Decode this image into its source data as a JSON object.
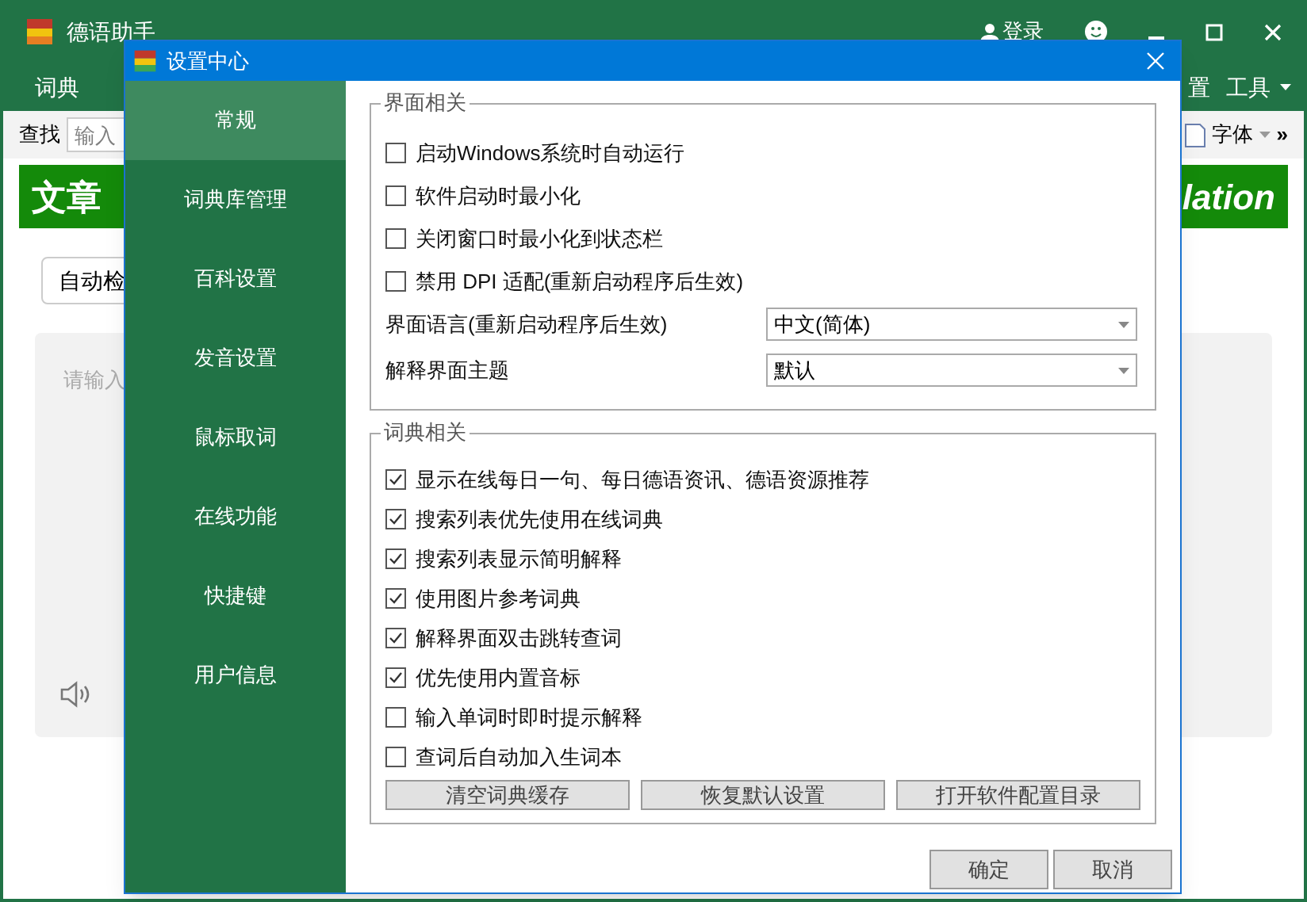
{
  "app": {
    "title": "德语助手",
    "login": "登录",
    "menu": [
      "词典",
      "置",
      "工具"
    ],
    "toolbar": {
      "search_label": "查找",
      "search_placeholder": "输入",
      "font": "字体",
      "more": "»"
    },
    "banner": {
      "left": "文章",
      "right": "lation"
    },
    "detect_button": "自动检",
    "input_placeholder": "请输入"
  },
  "dialog": {
    "title": "设置中心",
    "nav": [
      {
        "label": "常规",
        "selected": true
      },
      {
        "label": "词典库管理",
        "selected": false
      },
      {
        "label": "百科设置",
        "selected": false
      },
      {
        "label": "发音设置",
        "selected": false
      },
      {
        "label": "鼠标取词",
        "selected": false
      },
      {
        "label": "在线功能",
        "selected": false
      },
      {
        "label": "快捷键",
        "selected": false
      },
      {
        "label": "用户信息",
        "selected": false
      }
    ],
    "ui_group": {
      "title": "界面相关",
      "options": [
        {
          "label": "启动Windows系统时自动运行",
          "checked": false
        },
        {
          "label": "软件启动时最小化",
          "checked": false
        },
        {
          "label": "关闭窗口时最小化到状态栏",
          "checked": false
        },
        {
          "label": "禁用 DPI 适配(重新启动程序后生效)",
          "checked": false
        }
      ],
      "selects": [
        {
          "label": "界面语言(重新启动程序后生效)",
          "value": "中文(简体)"
        },
        {
          "label": "解释界面主题",
          "value": "默认"
        }
      ]
    },
    "dict_group": {
      "title": "词典相关",
      "options": [
        {
          "label": "显示在线每日一句、每日德语资讯、德语资源推荐",
          "checked": true
        },
        {
          "label": "搜索列表优先使用在线词典",
          "checked": true
        },
        {
          "label": "搜索列表显示简明解释",
          "checked": true
        },
        {
          "label": "使用图片参考词典",
          "checked": true
        },
        {
          "label": "解释界面双击跳转查词",
          "checked": true
        },
        {
          "label": "优先使用内置音标",
          "checked": true
        },
        {
          "label": "输入单词时即时提示解释",
          "checked": false
        },
        {
          "label": "查词后自动加入生词本",
          "checked": false
        }
      ],
      "buttons": [
        "清空词典缓存",
        "恢复默认设置",
        "打开软件配置目录"
      ]
    },
    "footer_buttons": [
      "确定",
      "取消"
    ]
  }
}
